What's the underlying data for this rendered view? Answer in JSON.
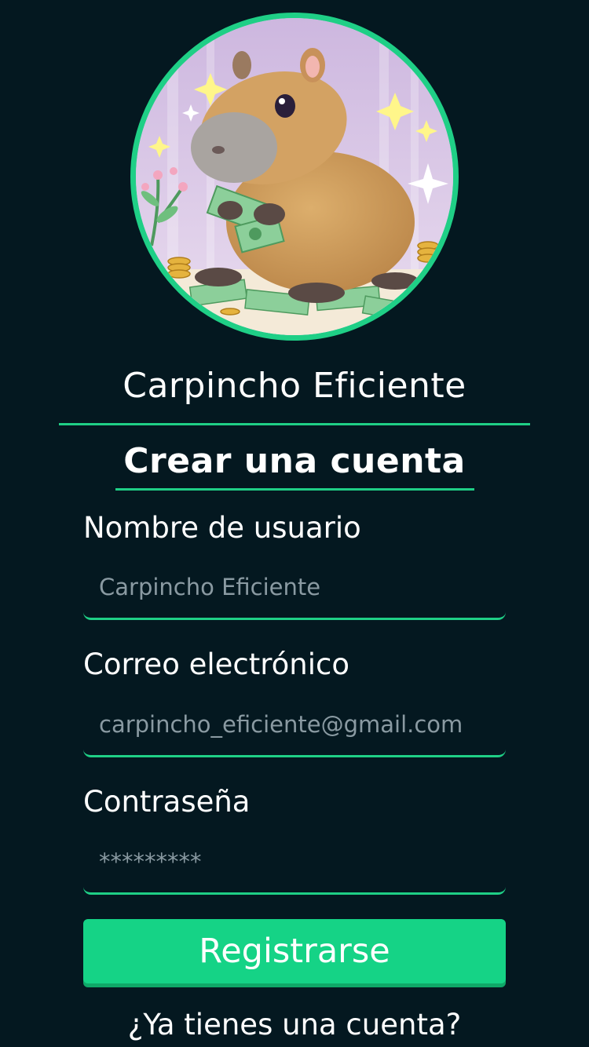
{
  "app": {
    "title": "Carpincho Eficiente"
  },
  "form": {
    "heading": "Crear una cuenta",
    "username": {
      "label": "Nombre de usuario",
      "placeholder": "Carpincho Eficiente"
    },
    "email": {
      "label": "Correo electrónico",
      "placeholder": "carpincho_eficiente@gmail.com"
    },
    "password": {
      "label": "Contraseña",
      "placeholder": "*********"
    },
    "submit_label": "Registrarse",
    "login_prompt": "¿Ya tienes una cuenta?"
  },
  "theme": {
    "background": "#041820",
    "accent": "#1fcf86",
    "button": "#15d386",
    "placeholder_text": "#8a9aa2"
  },
  "icons": {
    "avatar": "capybara-holding-money-illustration"
  }
}
